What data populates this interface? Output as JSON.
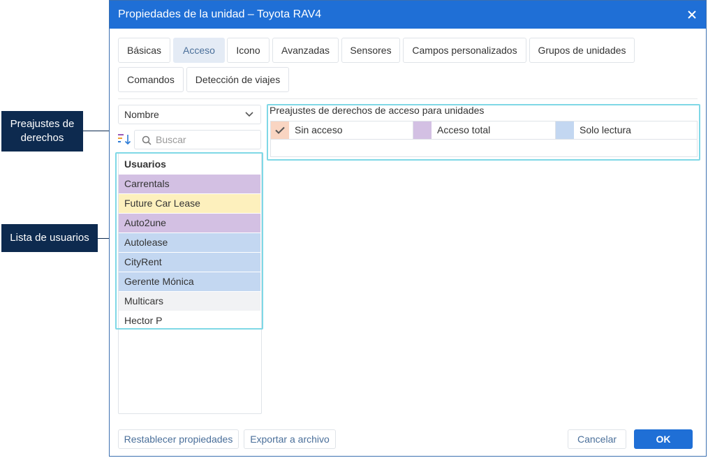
{
  "window": {
    "title": "Propiedades de la unidad – Toyota RAV4"
  },
  "tabs": [
    {
      "label": "Básicas",
      "active": false
    },
    {
      "label": "Acceso",
      "active": true
    },
    {
      "label": "Icono",
      "active": false
    },
    {
      "label": "Avanzadas",
      "active": false
    },
    {
      "label": "Sensores",
      "active": false
    },
    {
      "label": "Campos personalizados",
      "active": false
    },
    {
      "label": "Grupos de unidades",
      "active": false
    },
    {
      "label": "Comandos",
      "active": false
    },
    {
      "label": "Detección de viajes",
      "active": false
    }
  ],
  "sort_select": {
    "value": "Nombre"
  },
  "search": {
    "placeholder": "Buscar"
  },
  "users": {
    "header": "Usuarios",
    "items": [
      {
        "name": "Carrentals",
        "color": "#d3c0e3"
      },
      {
        "name": "Future Car Lease",
        "color": "#fdf0bd"
      },
      {
        "name": "Auto2une",
        "color": "#d3c0e3"
      },
      {
        "name": "Autolease",
        "color": "#c3d7f1"
      },
      {
        "name": "CityRent",
        "color": "#c3d7f1"
      },
      {
        "name": "Gerente Mónica",
        "color": "#c3d7f1"
      },
      {
        "name": "Multicars",
        "color": "#f1f2f4"
      },
      {
        "name": "Hector P",
        "color": "#ffffff"
      }
    ]
  },
  "presets": {
    "label": "Preajustes de derechos de acceso para unidades",
    "items": [
      {
        "name": "Sin acceso",
        "color": "#f9d5c2",
        "checked": true
      },
      {
        "name": "Acceso total",
        "color": "#d3c0e3",
        "checked": false
      },
      {
        "name": "Solo lectura",
        "color": "#c3d7f1",
        "checked": false
      }
    ]
  },
  "footer": {
    "reset_label": "Restablecer propiedades",
    "export_label": "Exportar a archivo",
    "cancel_label": "Cancelar",
    "ok_label": "OK"
  },
  "callouts": {
    "presets": "Preajustes de derechos",
    "users": "Lista de usuarios"
  },
  "colors": {
    "accent": "#1f6fd6",
    "highlight": "#7fd8e6",
    "callout": "#0d2a4f"
  }
}
